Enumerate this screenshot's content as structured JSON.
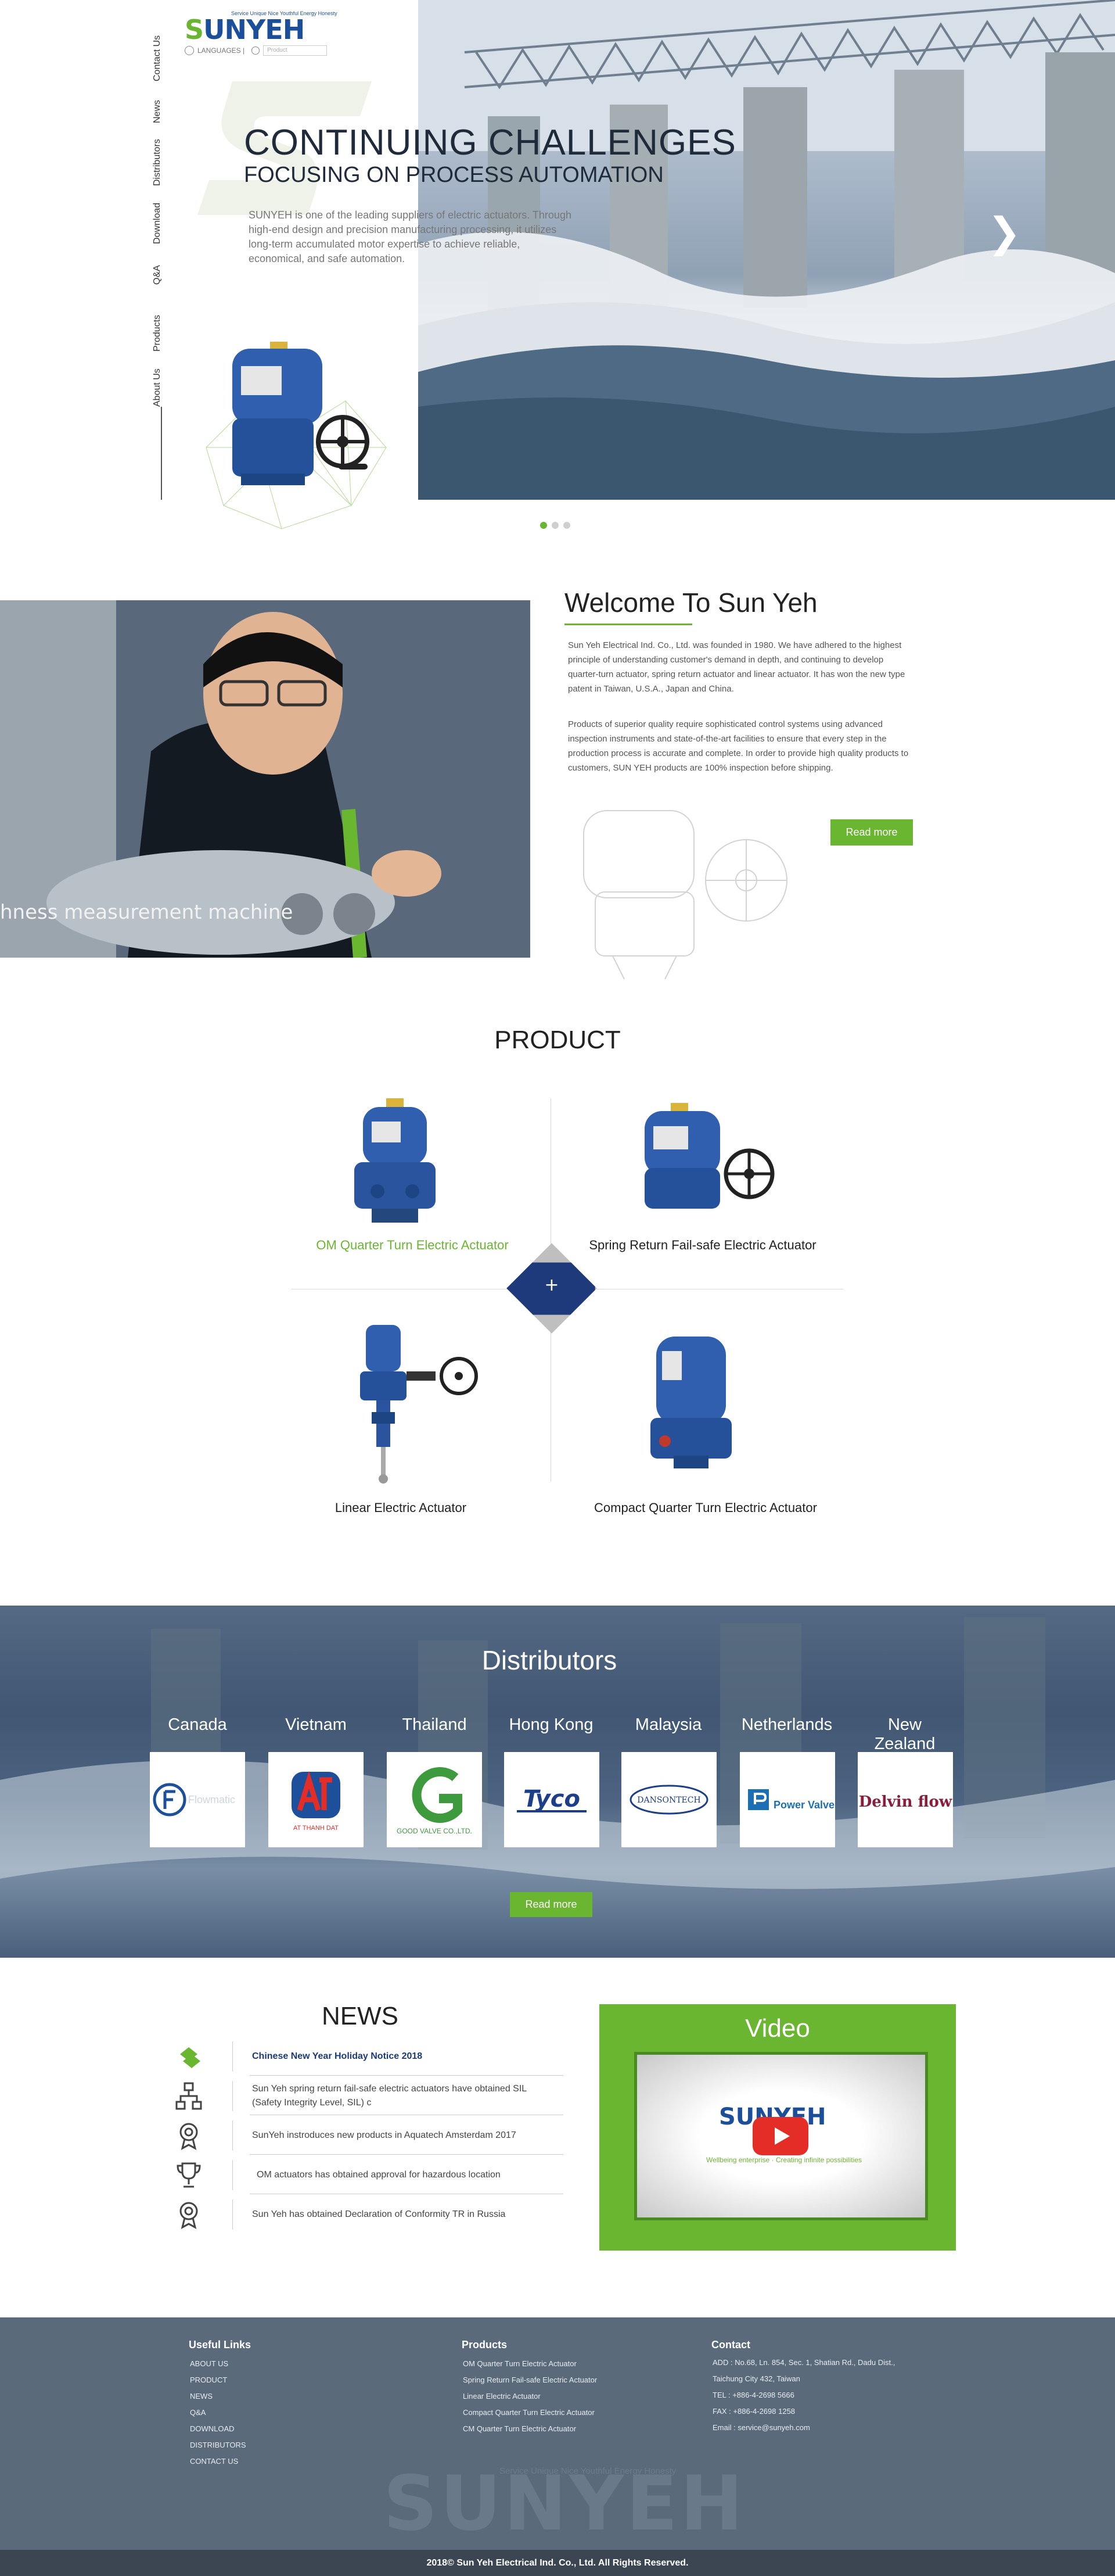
{
  "side_nav": [
    "Contact Us",
    "News",
    "Distributors",
    "Download",
    "Q&A",
    "Products",
    "About Us"
  ],
  "header": {
    "logo_text": "SUNYEH",
    "logo_tagline": "Service  Unique  Nice  Youthful  Energy  Honesty",
    "languages_label": "LANGUAGES |",
    "search_placeholder": "Product"
  },
  "hero": {
    "title": "CONTINUING CHALLENGES",
    "subtitle": "FOCUSING ON PROCESS AUTOMATION",
    "desc": "SUNYEH is one of the leading suppliers of electric actuators. Through high-end design and precision manufacturing processing, it utilizes long-term accumulated motor expertise to achieve reliable, economical, and safe automation.",
    "next_arrow": "❯",
    "slides_total": 3,
    "slide_active": 1
  },
  "welcome": {
    "title": "Welcome To Sun Yeh",
    "caption": "hness measurement machine",
    "p1": "Sun Yeh Electrical Ind. Co., Ltd. was founded in 1980. We have adhered to the highest principle of understanding customer's demand in depth, and continuing to develop quarter-turn actuator, spring return actuator and linear actuator. It has won the new type patent in Taiwan, U.S.A., Japan and China.",
    "p2": "Products of superior quality require sophisticated control systems using advanced inspection instruments and state-of-the-art facilities to ensure that every step in the production process is accurate and complete. In order to provide high quality products to customers, SUN YEH products are 100% inspection before shipping.",
    "more": "Read more"
  },
  "products": {
    "title": "PRODUCT",
    "plus": "+",
    "items": [
      "OM Quarter Turn Electric Actuator",
      "Spring Return Fail-safe Electric Actuator",
      "Linear Electric Actuator",
      "Compact Quarter Turn Electric Actuator"
    ]
  },
  "distributors": {
    "title": "Distributors",
    "countries": [
      "Canada",
      "Vietnam",
      "Thailand",
      "Hong Kong",
      "Malaysia",
      "Netherlands",
      "New Zealand"
    ],
    "logos": [
      "Flowmatic",
      "AT THANH DAT",
      "GOOD VALVE CO.,LTD.",
      "Tyco",
      "DANSONTECH",
      "Power Valves",
      "Delvin flow"
    ],
    "more": "Read more"
  },
  "news": {
    "title": "NEWS",
    "items": [
      "Chinese New Year Holiday Notice 2018",
      "Sun Yeh spring return fail-safe electric actuators have obtained SIL (Safety Integrity Level, SIL) c",
      "SunYeh instroduces new products in Aquatech Amsterdam 2017",
      "OM actuators has obtained approval for hazardous location",
      "Sun Yeh has obtained Declaration of Conformity TR in Russia"
    ]
  },
  "video": {
    "title": "Video",
    "logo": "SUNYEH",
    "sub": "Wellbeing enterprise · Creating infinite possibilities"
  },
  "footer": {
    "useful_links_title": "Useful Links",
    "useful_links": [
      "ABOUT US",
      "PRODUCT",
      "NEWS",
      "Q&A",
      "DOWNLOAD",
      "DISTRIBUTORS",
      "CONTACT US"
    ],
    "products_title": "Products",
    "products": [
      "OM Quarter Turn Electric Actuator",
      "Spring Return Fail-safe Electric Actuator",
      "Linear Electric Actuator",
      "Compact Quarter Turn Electric Actuator",
      "CM Quarter Turn Electric Actuator"
    ],
    "contact_title": "Contact",
    "contact": [
      "ADD : No.68, Ln. 854, Sec. 1, Shatian Rd., Dadu Dist.,",
      "Taichung City 432, Taiwan",
      "TEL : +886-4-2698 5666",
      "FAX : +886-4-2698 1258",
      "Email : service@sunyeh.com"
    ],
    "big_logo": "SUNYEH",
    "big_tagline": "Service  Unique  Nice  Youthful  Energy  Honesty",
    "copyright": "2018© Sun Yeh Electrical Ind. Co., Ltd. All Rights Reserved."
  },
  "colors": {
    "brand_green": "#6ab631",
    "brand_blue": "#1b4f9c",
    "footer_bg": "#5a6a7a"
  }
}
